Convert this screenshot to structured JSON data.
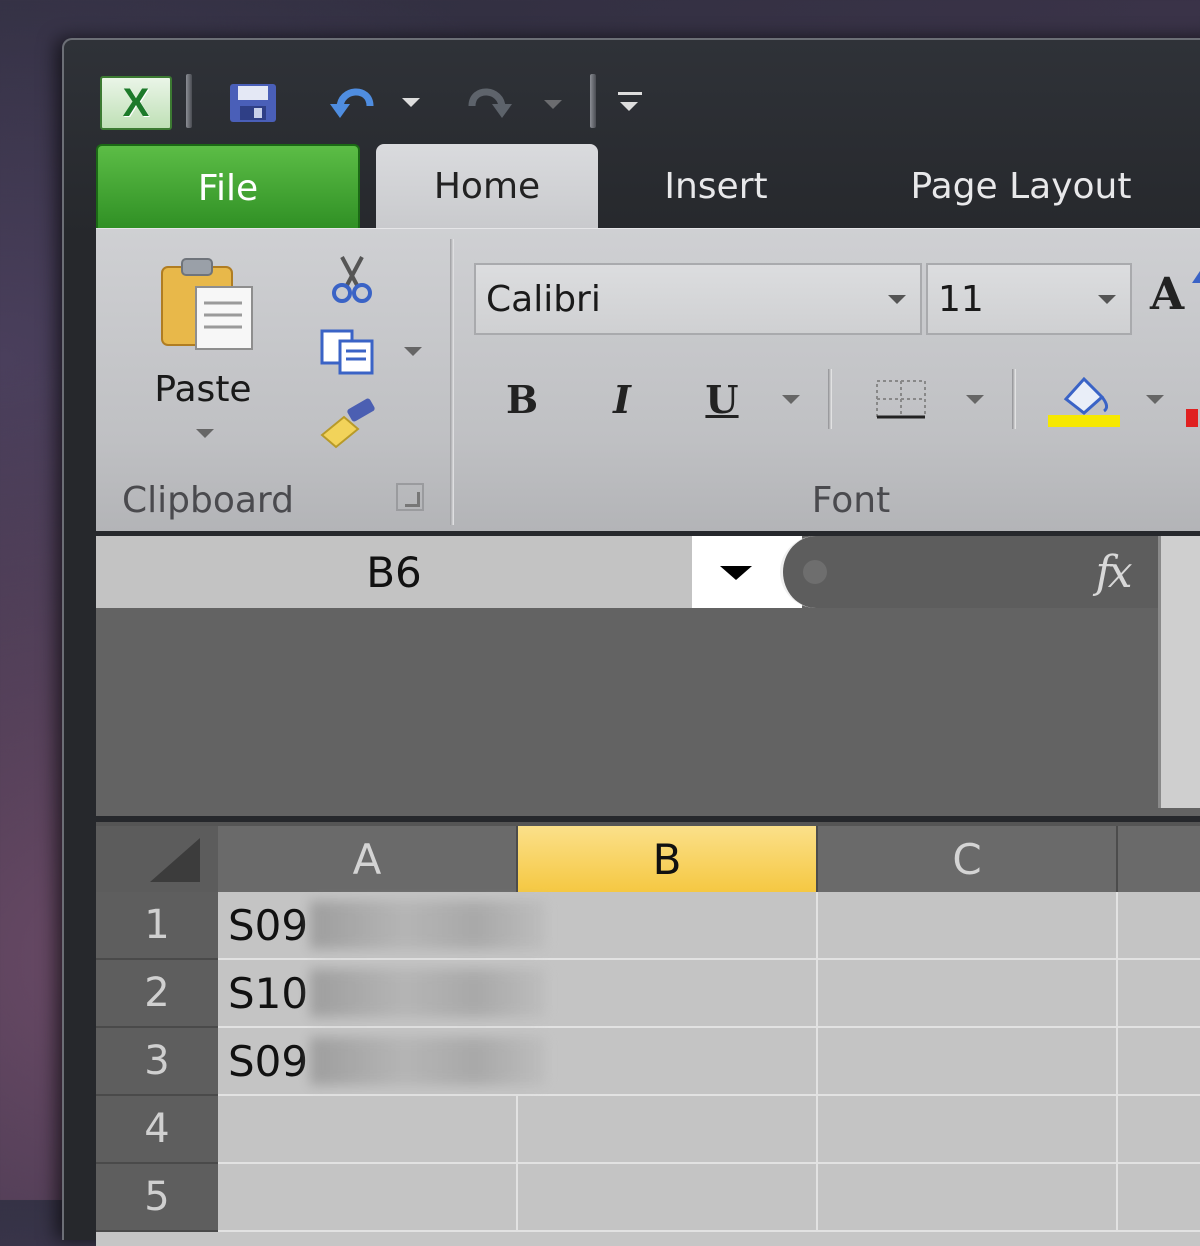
{
  "qat": {
    "app_icon": "excel-icon",
    "save": "save-icon",
    "undo": "undo-icon",
    "redo": "redo-icon",
    "customize": "customize-qat-icon"
  },
  "tabs": [
    {
      "label": "File"
    },
    {
      "label": "Home"
    },
    {
      "label": "Insert"
    },
    {
      "label": "Page Layout"
    }
  ],
  "clipboard": {
    "paste_label": "Paste",
    "group_label": "Clipboard"
  },
  "font": {
    "name": "Calibri",
    "size": "11",
    "group_label": "Font",
    "grow_label": "A",
    "bold": "B",
    "italic": "I",
    "underline": "U",
    "fill_color": "#f6e800"
  },
  "formula_bar": {
    "name_box": "B6",
    "fx": "fx"
  },
  "grid": {
    "columns": [
      "A",
      "B",
      "C"
    ],
    "active_column": "B",
    "rows": [
      "1",
      "2",
      "3",
      "4",
      "5"
    ],
    "cells_a": [
      "S09",
      "S10",
      "S09",
      "",
      ""
    ]
  }
}
